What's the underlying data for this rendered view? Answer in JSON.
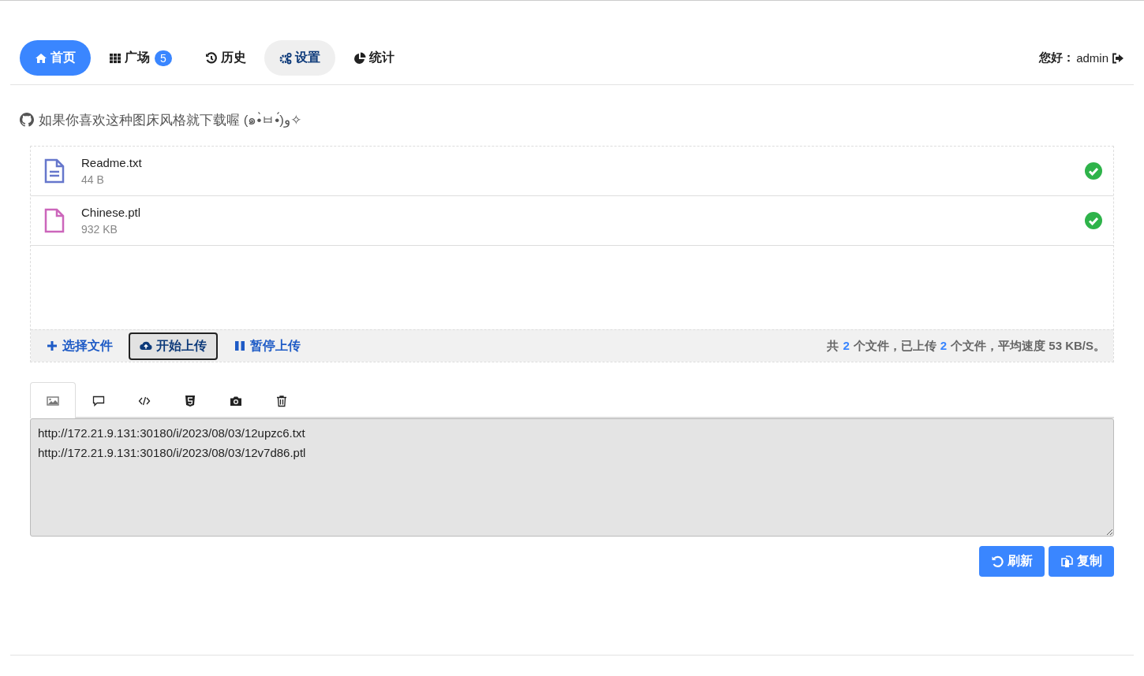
{
  "nav": {
    "tabs": [
      {
        "kind": "home",
        "label": "首页",
        "selected": true,
        "focused": false
      },
      {
        "kind": "grid",
        "label": "广场",
        "badge": "5",
        "selected": false,
        "focused": false
      },
      {
        "kind": "history",
        "label": "历史",
        "selected": false,
        "focused": false
      },
      {
        "kind": "settings",
        "label": "设置",
        "selected": false,
        "focused": true
      },
      {
        "kind": "stats",
        "label": "统计",
        "selected": false,
        "focused": false
      }
    ],
    "greeting": "您好：",
    "user": "admin"
  },
  "notice": "如果你喜欢这种图床风格就下载喔 (๑•̀ㅂ•́)و✧",
  "files": [
    {
      "kind": "text",
      "name": "Readme.txt",
      "size": "44 B",
      "done": true
    },
    {
      "kind": "blank",
      "name": "Chinese.ptl",
      "size": "932 KB",
      "done": true
    }
  ],
  "actions": [
    {
      "kind": "add",
      "label": "选择文件",
      "focused": false
    },
    {
      "kind": "upload",
      "label": "开始上传",
      "focused": true
    },
    {
      "kind": "pause",
      "label": "暂停上传",
      "focused": false
    }
  ],
  "status": [
    {
      "kind": "plain",
      "text": "共"
    },
    {
      "kind": "count",
      "text": "2"
    },
    {
      "kind": "plain",
      "text": "个文件，已上传"
    },
    {
      "kind": "count",
      "text": "2"
    },
    {
      "kind": "plain",
      "text": "个文件，平均速度 53 KB/S。"
    }
  ],
  "output_tabs": [
    {
      "kind": "image",
      "selected": true
    },
    {
      "kind": "comment",
      "selected": false
    },
    {
      "kind": "code",
      "selected": false
    },
    {
      "kind": "html5",
      "selected": false
    },
    {
      "kind": "camera",
      "selected": false
    },
    {
      "kind": "trash",
      "selected": false
    }
  ],
  "output": {
    "lines": [
      "http://172.21.9.131:30180/i/2023/08/03/12upzc6.txt",
      "http://172.21.9.131:30180/i/2023/08/03/12v7d86.ptl"
    ]
  },
  "buttons": [
    {
      "kind": "refresh",
      "label": "刷新"
    },
    {
      "kind": "copy",
      "label": "复制"
    }
  ]
}
